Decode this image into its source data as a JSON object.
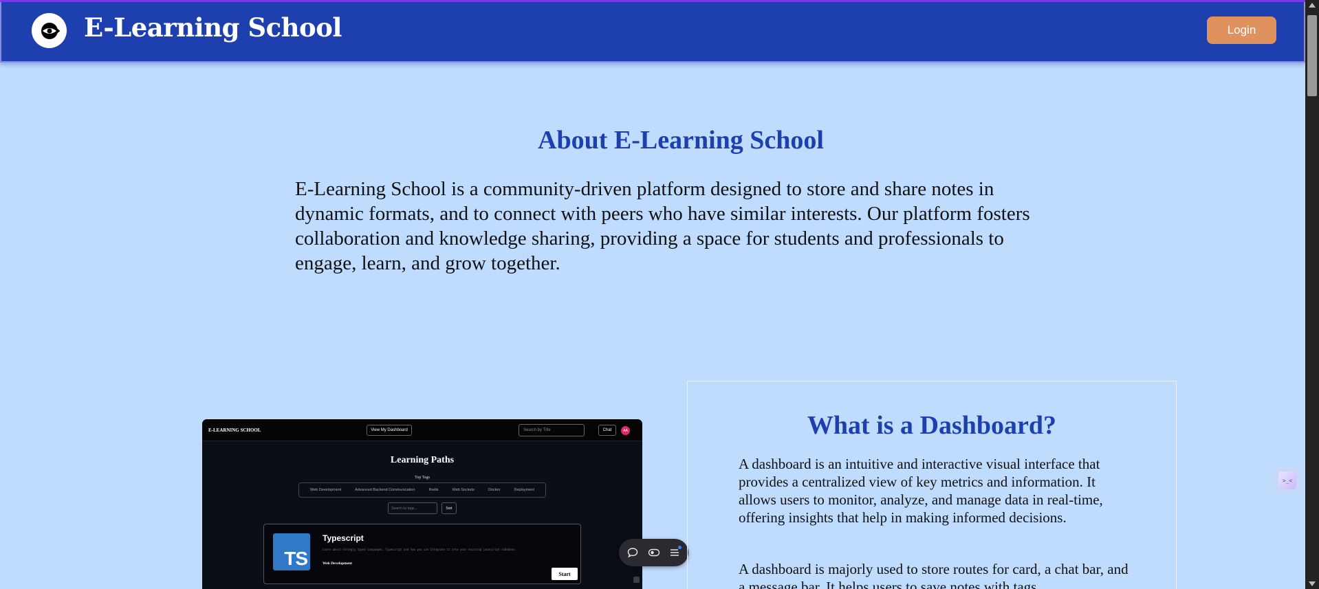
{
  "header": {
    "brand": "E-Learning School",
    "login_label": "Login",
    "logo_icon": "eye-logo-icon"
  },
  "about": {
    "title": "About E-Learning School",
    "text": "E-Learning School is a community-driven platform designed to store and share notes in dynamic formats, and to connect with peers who have similar interests. Our platform fosters collaboration and knowledge sharing, providing a space for students and professionals to engage, learn, and grow together."
  },
  "preview": {
    "brand": "E-LEARNING SCHOOL",
    "view_dashboard_label": "View My Dashboard",
    "search_placeholder": "Search by Title",
    "chat_label": "Chat",
    "avatar_initials": "AA",
    "title": "Learning Paths",
    "top_tags_label": "Top Tags",
    "tags": [
      "Web Development",
      "Advanced Backend Communication",
      "Redis",
      "Web Sockets",
      "Docker",
      "Deployment"
    ],
    "tag_search_placeholder": "Search by tags...",
    "sort_label": "Sort",
    "card": {
      "logo_text": "TS",
      "title": "Typescript",
      "description": "Learn about strongly typed languages, Typescript and how you can Integrate it into your existing javascript codebase.",
      "tag": "Web Development",
      "start_label": "Start"
    }
  },
  "floating_toolbar": {
    "icons": [
      "chat-bubble-icon",
      "toggle-icon",
      "menu-icon"
    ]
  },
  "dashboard": {
    "title": "What is a Dashboard?",
    "p1": "A dashboard is an intuitive and interactive visual interface that provides a centralized view of key metrics and information. It allows users to monitor, analyze, and manage data in real-time, offering insights that help in making informed decisions.",
    "p2": "A dashboard is majorly used to store routes for card, a chat bar, and a message bar. It helps users to save notes with tags"
  },
  "side_widget": {
    "face": ">_<"
  },
  "colors": {
    "navbar": "#1e40af",
    "login_button": "#e0925e",
    "page_background": "#bfdbfe",
    "heading": "#1e40af"
  }
}
